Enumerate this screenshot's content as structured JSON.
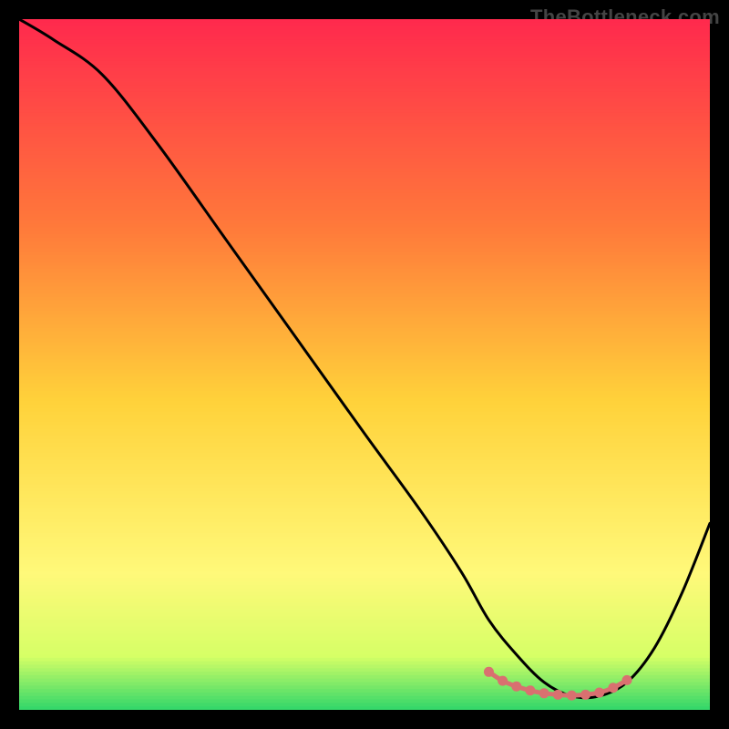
{
  "watermark": "TheBottleneck.com",
  "colors": {
    "top": "#ff2a4d",
    "mid_upper": "#ff7a3a",
    "mid": "#ffd23a",
    "lower": "#fff97a",
    "near_bottom": "#d6ff66",
    "bottom": "#2bd56a",
    "curve": "#000000",
    "markers": "#d97070"
  },
  "chart_data": {
    "type": "line",
    "title": "",
    "xlabel": "",
    "ylabel": "",
    "xlim": [
      0,
      100
    ],
    "ylim": [
      0,
      100
    ],
    "series": [
      {
        "name": "bottleneck-curve",
        "x": [
          0,
          5,
          12,
          20,
          30,
          40,
          50,
          58,
          64,
          68,
          72,
          76,
          80,
          84,
          88,
          92,
          96,
          100
        ],
        "y": [
          100,
          97,
          92,
          82,
          68,
          54,
          40,
          29,
          20,
          13,
          8,
          4,
          2,
          2,
          4,
          9,
          17,
          27
        ]
      }
    ],
    "markers": {
      "name": "optimal-range",
      "x": [
        68,
        70,
        72,
        74,
        76,
        78,
        80,
        82,
        84,
        86,
        88
      ],
      "y": [
        5.5,
        4.2,
        3.4,
        2.8,
        2.4,
        2.2,
        2.1,
        2.2,
        2.5,
        3.2,
        4.3
      ]
    },
    "gradient_stops": [
      {
        "offset": 0,
        "key": "top"
      },
      {
        "offset": 0.3,
        "key": "mid_upper"
      },
      {
        "offset": 0.55,
        "key": "mid"
      },
      {
        "offset": 0.8,
        "key": "lower"
      },
      {
        "offset": 0.92,
        "key": "near_bottom"
      },
      {
        "offset": 1.0,
        "key": "bottom"
      }
    ]
  }
}
